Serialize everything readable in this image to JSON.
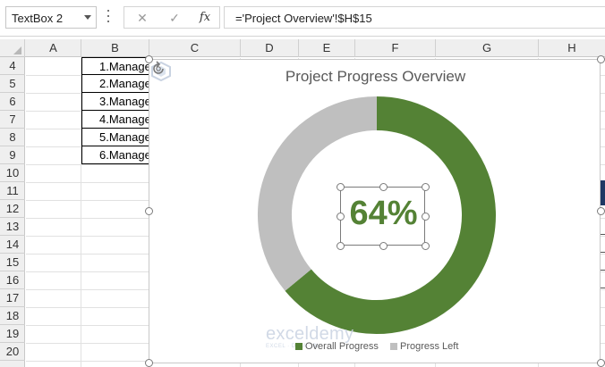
{
  "formula_bar": {
    "name_box": "TextBox 2",
    "cancel_icon": "✕",
    "enter_icon": "✓",
    "fx_label": "fx",
    "formula": "='Project Overview'!$H$15"
  },
  "columns": [
    "A",
    "B",
    "C",
    "D",
    "E",
    "F",
    "G",
    "H"
  ],
  "rows": [
    "4",
    "5",
    "6",
    "7",
    "8",
    "9",
    "10",
    "11",
    "12",
    "13",
    "14",
    "15",
    "16",
    "17",
    "18",
    "19",
    "20"
  ],
  "table_cells": [
    "1.Manage",
    "2.Manage",
    "3.Manage",
    "4.Manage",
    "5.Manage",
    "6.Manage"
  ],
  "chart": {
    "title": "Project Progress Overview",
    "center_label": "64%",
    "legend": [
      "Overall Progress",
      "Progress Left"
    ],
    "watermark": "exceldemy",
    "watermark_sub": "EXCEL · DATA · BI"
  },
  "chart_data": {
    "type": "doughnut",
    "title": "Project Progress Overview",
    "categories": [
      "Overall Progress",
      "Progress Left"
    ],
    "values": [
      64,
      36
    ],
    "colors": [
      "#548235",
      "#bfbfbf"
    ],
    "legend_position": "bottom"
  }
}
